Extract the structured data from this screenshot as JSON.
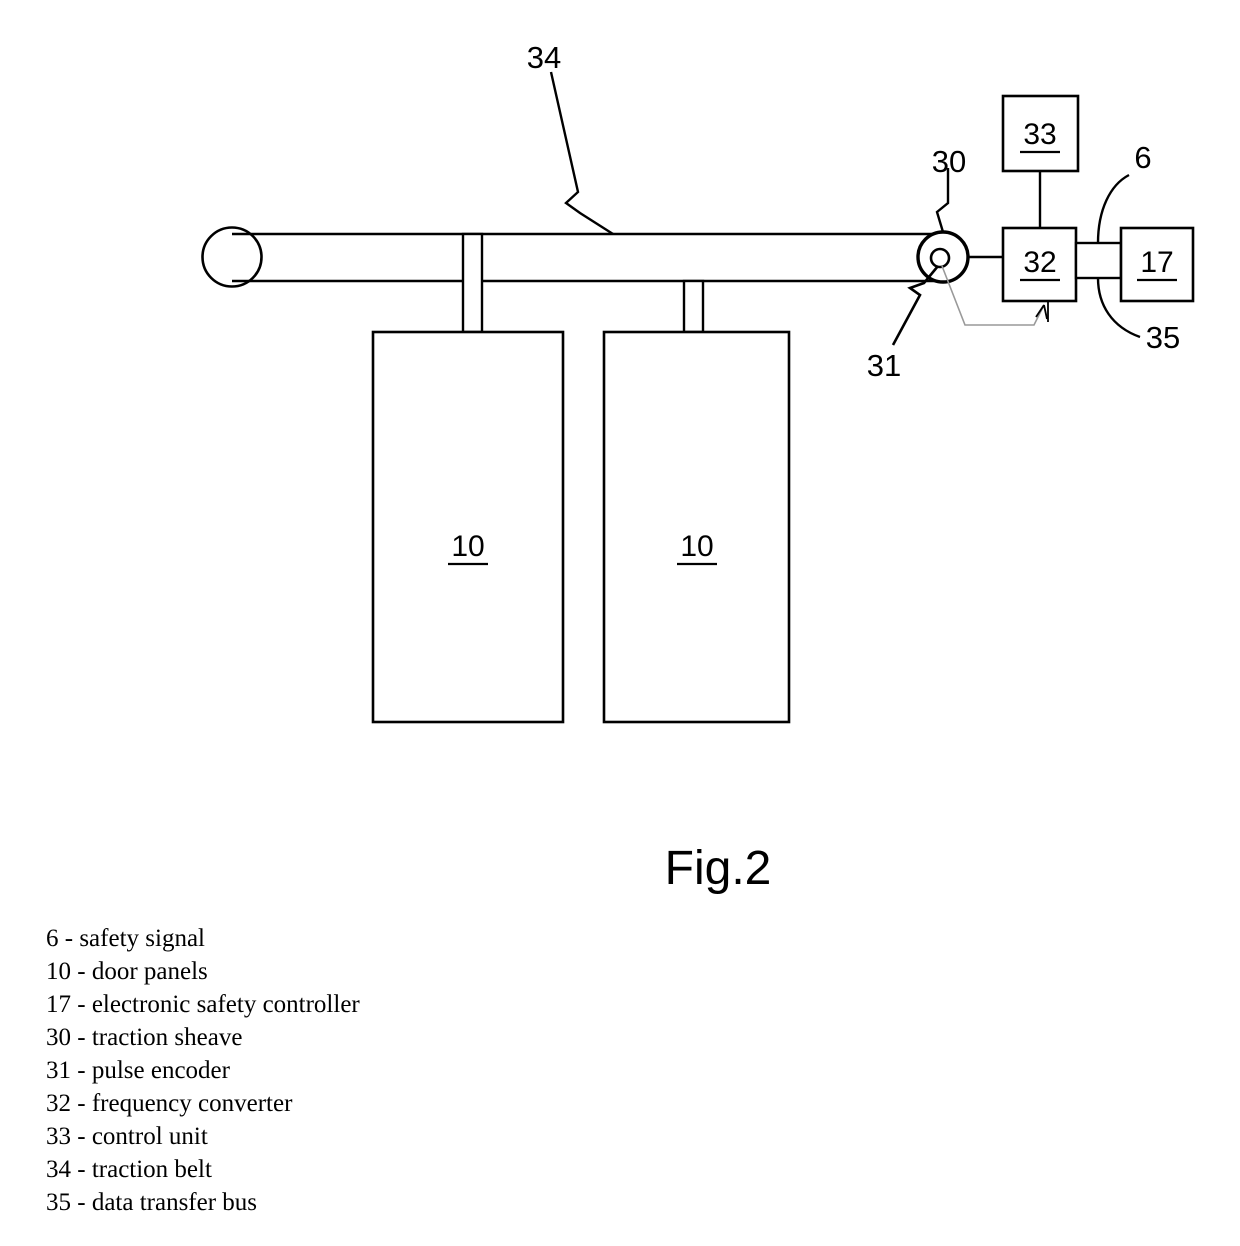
{
  "figure": {
    "caption": "Fig.2",
    "reference_numerals": {
      "traction_belt": "34",
      "traction_sheave": "30",
      "pulse_encoder": "31",
      "frequency_converter": "32",
      "control_unit": "33",
      "electronic_safety_controller": "17",
      "safety_signal": "6",
      "data_transfer_bus": "35",
      "door_panel_left": "10",
      "door_panel_right": "10"
    }
  },
  "boxes": [
    {
      "id": "control-unit",
      "label": "33"
    },
    {
      "id": "frequency-converter",
      "label": "32"
    },
    {
      "id": "electronic-safety-controller",
      "label": "17"
    },
    {
      "id": "door-panel-left",
      "label": "10"
    },
    {
      "id": "door-panel-right",
      "label": "10"
    }
  ],
  "callouts": [
    {
      "id": "callout-34",
      "label": "34"
    },
    {
      "id": "callout-30",
      "label": "30"
    },
    {
      "id": "callout-31",
      "label": "31"
    },
    {
      "id": "callout-6",
      "label": "6"
    },
    {
      "id": "callout-35",
      "label": "35"
    }
  ],
  "legend": {
    "items": [
      "6 - safety signal",
      "10 - door panels",
      "17 - electronic safety controller",
      "30 - traction sheave",
      "31 - pulse encoder",
      "32 - frequency converter",
      "33 - control unit",
      "34 - traction belt",
      "35 - data transfer bus"
    ]
  },
  "colors": {
    "ink": "#000000",
    "paper": "#ffffff",
    "faint_line": "#999999"
  }
}
